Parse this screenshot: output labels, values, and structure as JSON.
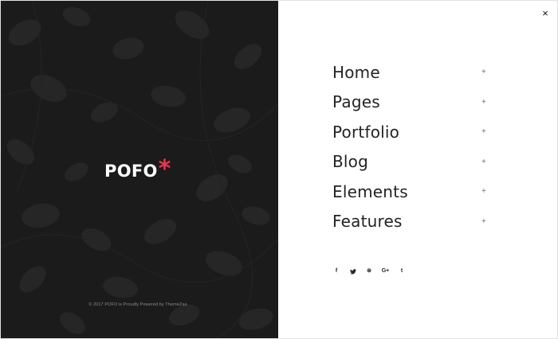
{
  "brand": {
    "name": "POFO",
    "accent": "*",
    "accent_color": "#f0334f"
  },
  "copyright": "© 2017 POFO is Proudly Powered by ThemeZaa",
  "close_icon": "×",
  "menu": [
    {
      "label": "Home",
      "expand": "+"
    },
    {
      "label": "Pages",
      "expand": "+"
    },
    {
      "label": "Portfolio",
      "expand": "+"
    },
    {
      "label": "Blog",
      "expand": "+"
    },
    {
      "label": "Elements",
      "expand": "+"
    },
    {
      "label": "Features",
      "expand": "+"
    }
  ],
  "social": [
    {
      "icon": "facebook-icon",
      "glyph": "f"
    },
    {
      "icon": "twitter-icon",
      "glyph": "🐦"
    },
    {
      "icon": "dribbble-icon",
      "glyph": "⊛"
    },
    {
      "icon": "google-plus-icon",
      "glyph": "G+"
    },
    {
      "icon": "tumblr-icon",
      "glyph": "t"
    }
  ],
  "colors": {
    "left_panel": "#1b1b1b",
    "right_panel": "#ffffff",
    "text": "#232323"
  }
}
